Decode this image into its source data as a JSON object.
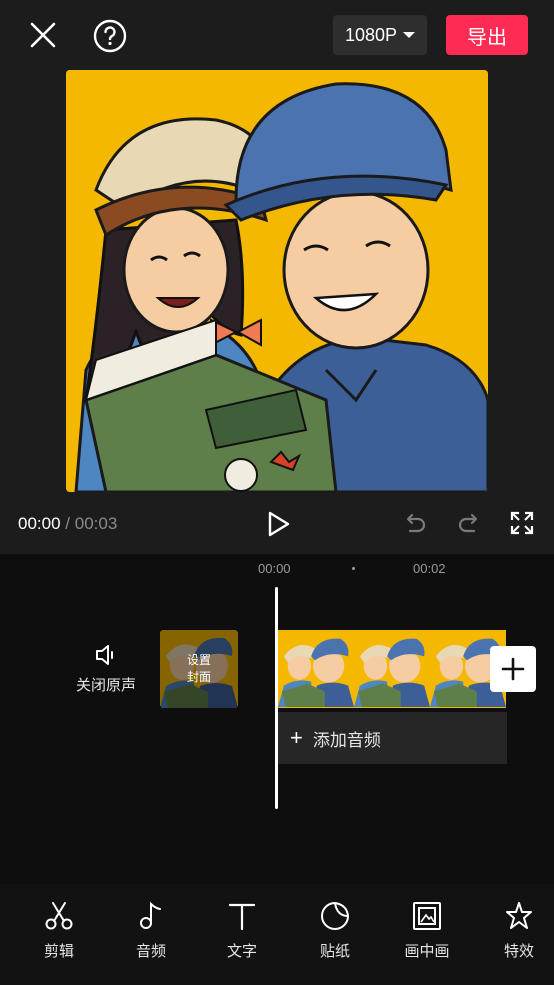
{
  "header": {
    "resolution_label": "1080P",
    "export_label": "导出"
  },
  "playback": {
    "current_time": "00:00",
    "separator": "/",
    "total_time": "00:03"
  },
  "timeline": {
    "ruler_marks": [
      "00:00",
      "00:02"
    ],
    "mute_label": "关闭原声",
    "cover_label_line1": "设置",
    "cover_label_line2": "封面",
    "add_audio_label": "添加音频"
  },
  "toolbar": {
    "items": [
      {
        "label": "剪辑",
        "icon": "scissors-icon"
      },
      {
        "label": "音频",
        "icon": "music-note-icon"
      },
      {
        "label": "文字",
        "icon": "text-icon"
      },
      {
        "label": "贴纸",
        "icon": "sticker-icon"
      },
      {
        "label": "画中画",
        "icon": "picture-in-picture-icon"
      },
      {
        "label": "特效",
        "icon": "effects-star-icon"
      }
    ]
  },
  "colors": {
    "accent": "#fe2c55",
    "preview_background": "#f5b800"
  }
}
